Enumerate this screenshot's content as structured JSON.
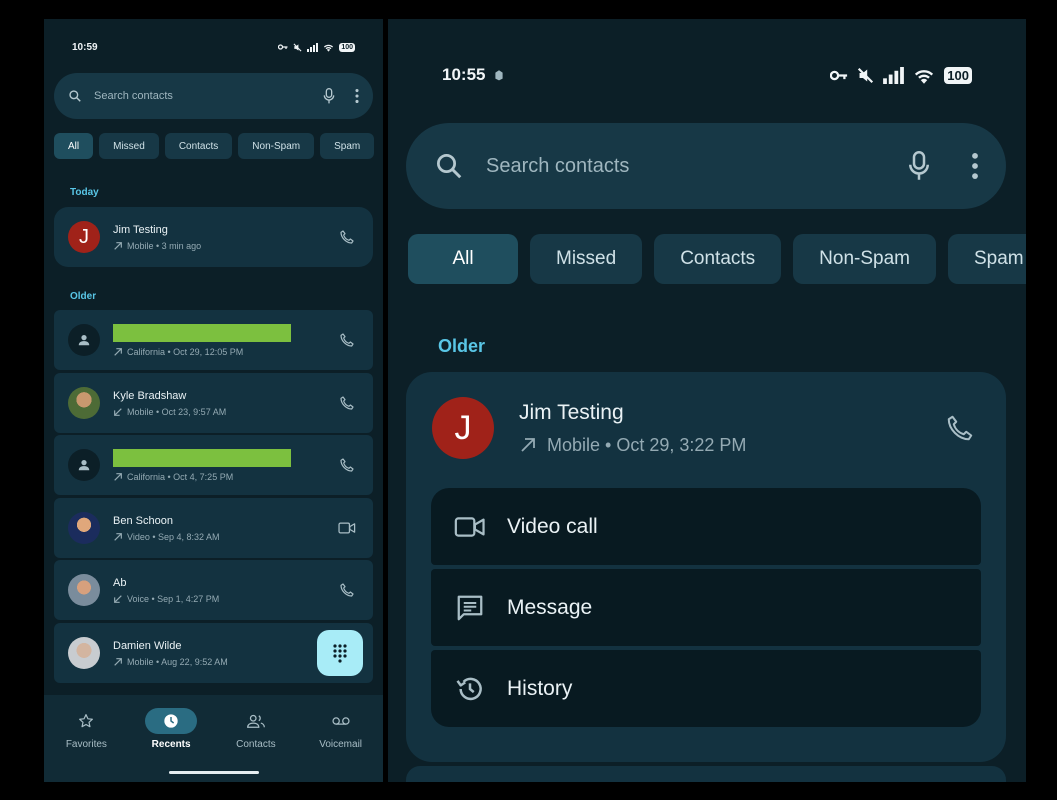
{
  "left": {
    "status": {
      "time": "10:59",
      "battery": "100"
    },
    "search": {
      "placeholder": "Search contacts"
    },
    "chips": [
      "All",
      "Missed",
      "Contacts",
      "Non-Spam",
      "Spam"
    ],
    "today_label": "Today",
    "older_label": "Older",
    "today_row": {
      "name": "Jim Testing",
      "initial": "J",
      "meta": "Mobile • 3 min ago",
      "direction": "outgoing",
      "action": "phone"
    },
    "older_rows": [
      {
        "name": "",
        "redacted": true,
        "meta": "California • Oct 29, 12:05 PM",
        "direction": "outgoing",
        "action": "phone",
        "avatar": "generic"
      },
      {
        "name": "Kyle Bradshaw",
        "meta": "Mobile • Oct 23, 9:57 AM",
        "direction": "incoming",
        "action": "phone",
        "avatar": "photo"
      },
      {
        "name": "",
        "redacted": true,
        "meta": "California • Oct 4, 7:25 PM",
        "direction": "outgoing",
        "action": "phone",
        "avatar": "generic"
      },
      {
        "name": "Ben Schoon",
        "meta": "Video • Sep 4, 8:32 AM",
        "direction": "outgoing",
        "action": "video",
        "avatar": "photo"
      },
      {
        "name": "Ab",
        "meta": "Voice • Sep 1, 4:27 PM",
        "direction": "incoming",
        "action": "phone",
        "avatar": "photo"
      },
      {
        "name": "Damien Wilde",
        "meta": "Mobile • Aug 22, 9:52 AM",
        "direction": "outgoing",
        "action": "dialpad",
        "avatar": "photo"
      }
    ],
    "nav": {
      "favorites": "Favorites",
      "recents": "Recents",
      "contacts": "Contacts",
      "voicemail": "Voicemail"
    }
  },
  "right": {
    "status": {
      "time": "10:55",
      "battery": "100"
    },
    "search": {
      "placeholder": "Search contacts"
    },
    "chips": [
      "All",
      "Missed",
      "Contacts",
      "Non-Spam",
      "Spam"
    ],
    "older_label": "Older",
    "contact": {
      "name": "Jim Testing",
      "initial": "J",
      "meta": "Mobile • Oct 29, 3:22 PM"
    },
    "actions": {
      "video_call": "Video call",
      "message": "Message",
      "history": "History"
    }
  },
  "colors": {
    "background": "#0c1f27",
    "card": "#133240",
    "accent": "#59c6e6",
    "fab": "#a8ecf7",
    "avatar_red": "#a02219",
    "redaction": "#7cc03f"
  }
}
